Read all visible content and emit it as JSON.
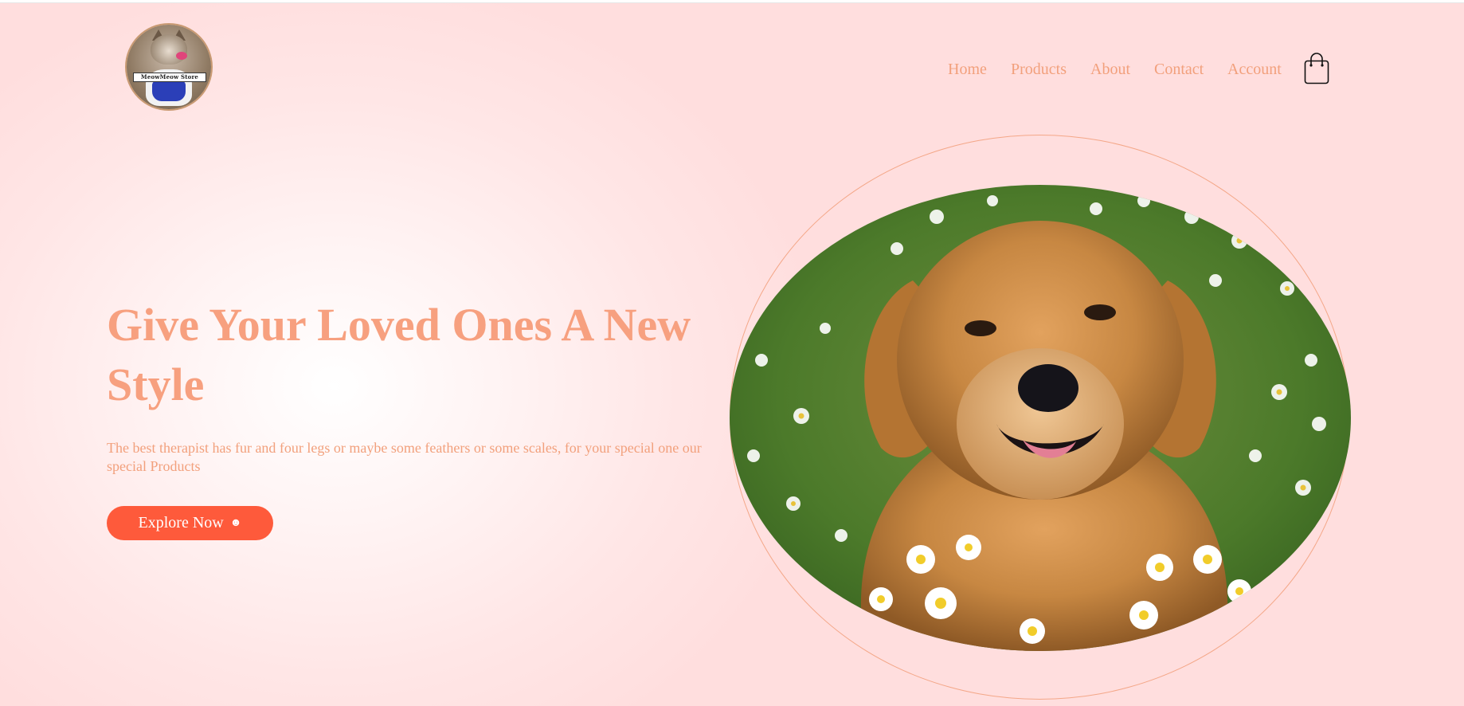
{
  "header": {
    "logo_text": "MeowMeow Store",
    "nav": [
      {
        "label": "Home"
      },
      {
        "label": "Products"
      },
      {
        "label": "About"
      },
      {
        "label": "Contact"
      },
      {
        "label": "Account"
      }
    ],
    "cart_icon": "shopping-bag-icon"
  },
  "hero": {
    "title": "Give Your Loved Ones A New Style",
    "subtitle": "The best therapist has fur and four legs or maybe some feathers or some scales, for your special one our special Products",
    "cta_label": "Explore Now",
    "cta_icon": "☻",
    "image_subject": "golden-retriever-in-daisy-field"
  },
  "colors": {
    "accent": "#f7a07f",
    "button": "#fe5a3b",
    "background": "#ffdede",
    "ring": "#f4a788"
  }
}
